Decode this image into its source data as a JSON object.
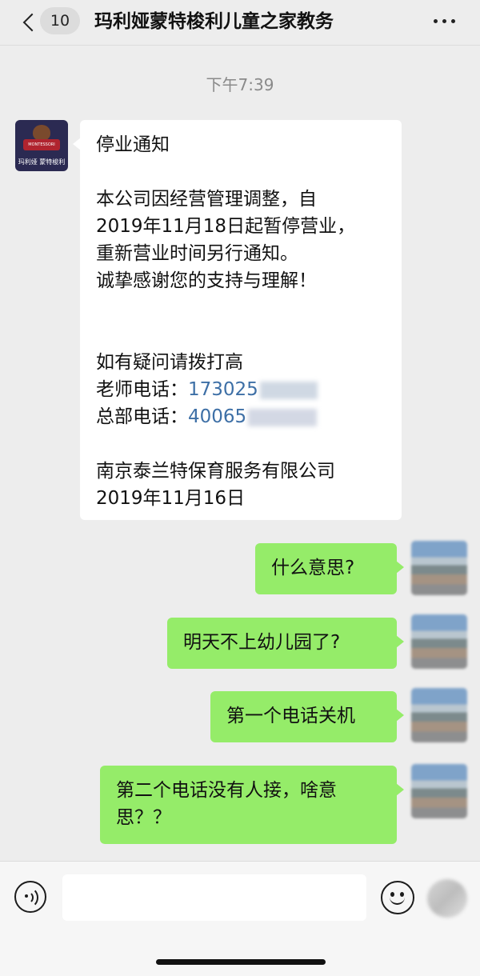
{
  "header": {
    "unread_count": "10",
    "title": "玛利娅蒙特梭利儿童之家教务"
  },
  "chat": {
    "timestamp": "下午7:39",
    "contact_avatar": {
      "ribbon": "MONTESSORI",
      "caption": "玛利娅 蒙特梭利"
    },
    "notice": {
      "title": "停业通知",
      "body": [
        "本公司因经营管理调整，自",
        "2019年11月18日起暂停营业，",
        "重新营业时间另行通知。",
        "诚挚感谢您的支持与理解！"
      ],
      "contact_intro": "如有疑问请拨打高",
      "teacher_label": "老师电话：",
      "teacher_phone": "173025",
      "hq_label": "总部电话：",
      "hq_phone": "40065",
      "company": "南京泰兰特保育服务有限公司",
      "date": "2019年11月16日"
    },
    "replies": [
      {
        "lines": [
          "什么意思?"
        ]
      },
      {
        "lines": [
          "明天不上幼儿园了?"
        ]
      },
      {
        "lines": [
          "第一个电话关机"
        ]
      },
      {
        "lines": [
          "第二个电话没有人接，啥意",
          "思？？"
        ]
      }
    ]
  },
  "colors": {
    "sent_bubble": "#95ec69",
    "received_bubble": "#ffffff",
    "background": "#ededed",
    "link_phone": "#3d6fa6"
  },
  "input_bar": {
    "value": "",
    "placeholder": ""
  },
  "icons": {
    "back": "chevron-left-icon",
    "more": "more-horizontal-icon",
    "voice": "voice-icon",
    "emoji": "emoji-icon",
    "plus": "plus-icon"
  }
}
